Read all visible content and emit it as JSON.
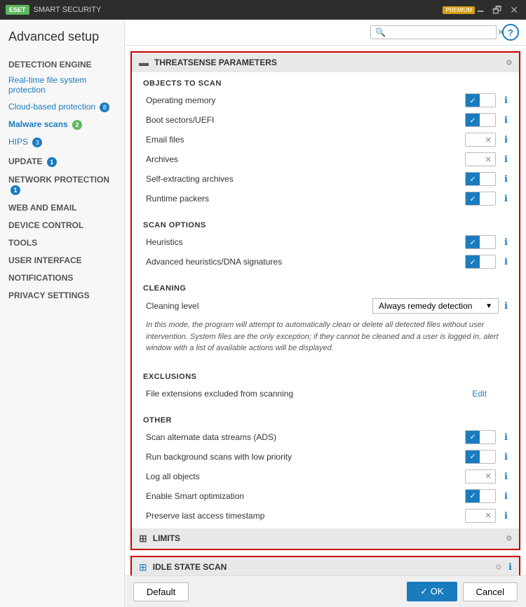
{
  "titlebar": {
    "logo": "ESET",
    "title": "SMART SECURITY",
    "badge": "PREMIUM",
    "minimize": "🗕",
    "maximize": "🗗",
    "close": "✕"
  },
  "sidebar": {
    "main_title": "Advanced setup",
    "items": [
      {
        "id": "detection-engine",
        "label": "DETECTION ENGINE",
        "type": "section",
        "badge": null
      },
      {
        "id": "realtime",
        "label": "Real-time file system protection",
        "type": "link",
        "badge": null
      },
      {
        "id": "cloud",
        "label": "Cloud-based protection",
        "type": "link",
        "badge": "8",
        "badge_color": "blue"
      },
      {
        "id": "malware",
        "label": "Malware scans",
        "type": "link",
        "badge": "2",
        "badge_color": "green",
        "active": true
      },
      {
        "id": "hips",
        "label": "HIPS",
        "type": "link",
        "badge": "3",
        "badge_color": "blue"
      },
      {
        "id": "update",
        "label": "UPDATE",
        "type": "section",
        "badge": "1",
        "badge_color": "blue"
      },
      {
        "id": "network",
        "label": "NETWORK PROTECTION",
        "type": "section",
        "badge": "1",
        "badge_color": "blue"
      },
      {
        "id": "web",
        "label": "WEB AND EMAIL",
        "type": "section",
        "badge": null
      },
      {
        "id": "device",
        "label": "DEVICE CONTROL",
        "type": "section",
        "badge": null
      },
      {
        "id": "tools",
        "label": "TOOLS",
        "type": "section",
        "badge": null
      },
      {
        "id": "ui",
        "label": "USER INTERFACE",
        "type": "section",
        "badge": null
      },
      {
        "id": "notifications",
        "label": "NOTIFICATIONS",
        "type": "section",
        "badge": null
      },
      {
        "id": "privacy",
        "label": "PRIVACY SETTINGS",
        "type": "section",
        "badge": null
      }
    ]
  },
  "search": {
    "placeholder": "",
    "value": ""
  },
  "help_label": "?",
  "threatsense": {
    "section_title": "THREATSENSE PARAMETERS",
    "objects_to_scan": {
      "title": "OBJECTS TO SCAN",
      "items": [
        {
          "label": "Operating memory",
          "state": "on"
        },
        {
          "label": "Boot sectors/UEFI",
          "state": "on"
        },
        {
          "label": "Email files",
          "state": "off_x"
        },
        {
          "label": "Archives",
          "state": "off_x"
        },
        {
          "label": "Self-extracting archives",
          "state": "on"
        },
        {
          "label": "Runtime packers",
          "state": "on"
        }
      ]
    },
    "scan_options": {
      "title": "SCAN OPTIONS",
      "items": [
        {
          "label": "Heuristics",
          "state": "on"
        },
        {
          "label": "Advanced heuristics/DNA signatures",
          "state": "on"
        }
      ]
    },
    "cleaning": {
      "title": "CLEANING",
      "level_label": "Cleaning level",
      "level_value": "Always remedy detection",
      "description": "In this mode, the program will attempt to automatically clean or delete all detected files without user intervention. System files are the only exception; if they cannot be cleaned and a user is logged in, alert window with a list of available actions will be displayed."
    },
    "exclusions": {
      "title": "EXCLUSIONS",
      "file_ext_label": "File extensions excluded from scanning",
      "edit_label": "Edit"
    },
    "other": {
      "title": "OTHER",
      "items": [
        {
          "label": "Scan alternate data streams (ADS)",
          "state": "on"
        },
        {
          "label": "Run background scans with low priority",
          "state": "on"
        },
        {
          "label": "Log all objects",
          "state": "off_x"
        },
        {
          "label": "Enable Smart optimization",
          "state": "on"
        },
        {
          "label": "Preserve last access timestamp",
          "state": "off_x"
        }
      ]
    }
  },
  "limits": {
    "section_title": "LIMITS"
  },
  "idle_scan": {
    "section_title": "IDLE STATE SCAN"
  },
  "footer": {
    "default_label": "Default",
    "ok_label": "✓ OK",
    "cancel_label": "Cancel"
  }
}
